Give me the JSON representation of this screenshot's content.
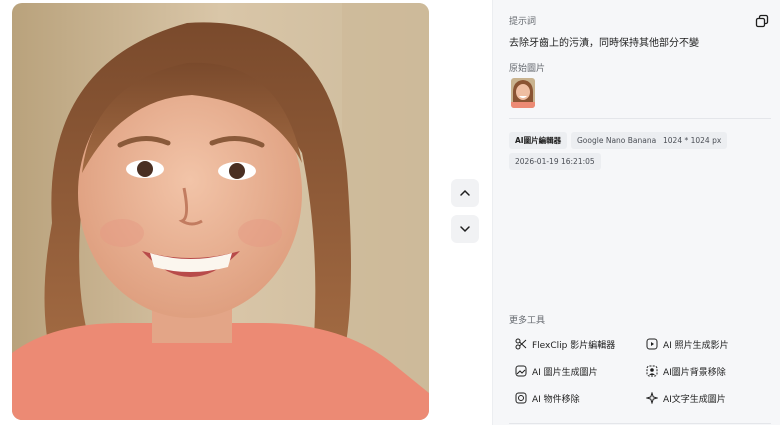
{
  "photo": {
    "alt_subject": "smiling-girl-photo"
  },
  "nav": {
    "prev_icon": "chevron-up-icon",
    "next_icon": "chevron-down-icon"
  },
  "panel": {
    "prompt_label": "提示詞",
    "prompt_text": "去除牙齒上的污漬，同時保持其他部分不變",
    "original_label": "原始圖片",
    "tags": [
      "AI圖片編輯器",
      "Google Nano Banana",
      "1024 * 1024 px",
      "2026-01-19 16:21:05"
    ],
    "more_tools_label": "更多工具",
    "tools": [
      {
        "label": "FlexClip 影片編輯器",
        "icon": "scissors-icon"
      },
      {
        "label": "AI 照片生成影片",
        "icon": "photo-video-icon"
      },
      {
        "label": "AI 圖片生成圖片",
        "icon": "image-to-image-icon"
      },
      {
        "label": "AI圖片背景移除",
        "icon": "background-remove-icon"
      },
      {
        "label": "AI 物件移除",
        "icon": "object-remove-icon"
      },
      {
        "label": "AI文字生成圖片",
        "icon": "text-to-image-icon"
      }
    ]
  },
  "colors": {
    "panel_bg": "#f6f7f9",
    "tag_bg": "#eceef1",
    "text": "#1f1f1f",
    "muted": "#666a70"
  }
}
